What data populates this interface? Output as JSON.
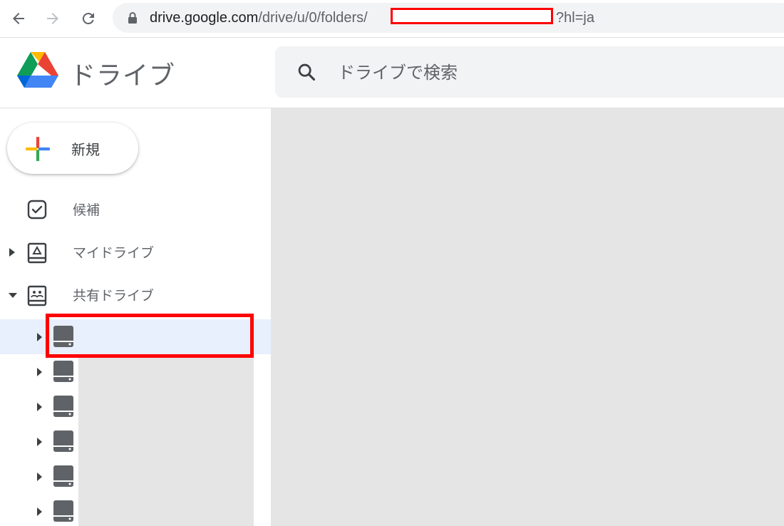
{
  "browser": {
    "url_host": "drive.google.com",
    "url_path": "/drive/u/0/folders/",
    "url_tail": "?hl=ja"
  },
  "app": {
    "title": "ドライブ"
  },
  "search": {
    "placeholder": "ドライブで検索"
  },
  "sidebar": {
    "new_label": "新規",
    "items": [
      {
        "label": "候補",
        "icon": "checkbox-icon"
      },
      {
        "label": "マイドライブ",
        "icon": "my-drive-icon"
      },
      {
        "label": "共有ドライブ",
        "icon": "shared-drives-icon"
      }
    ],
    "shared_drives": [
      {
        "name": "",
        "icon": "drive-disk-icon"
      },
      {
        "name": "",
        "icon": "drive-disk-icon"
      },
      {
        "name": "",
        "icon": "drive-disk-icon"
      },
      {
        "name": "",
        "icon": "drive-disk-icon"
      },
      {
        "name": "",
        "icon": "drive-disk-icon"
      },
      {
        "name": "",
        "icon": "drive-disk-icon"
      }
    ]
  },
  "colors": {
    "highlight": "#ff0000",
    "active_row": "#e8f0fe",
    "placeholder_grey": "#e5e5e5"
  }
}
